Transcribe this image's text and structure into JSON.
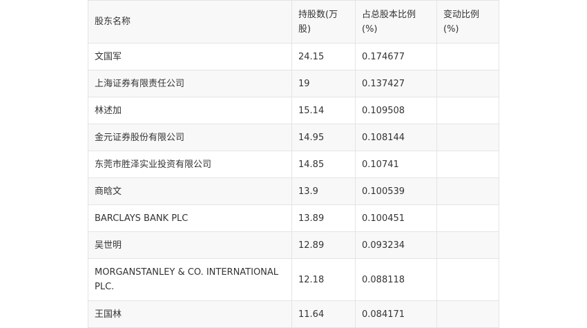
{
  "table": {
    "headers": [
      "股东名称",
      "持股数(万股)",
      "占总股本比例(%)",
      "变动比例(%)"
    ],
    "rows": [
      [
        "文国军",
        "24.15",
        "0.174677",
        ""
      ],
      [
        "上海证券有限责任公司",
        "19",
        "0.137427",
        ""
      ],
      [
        "林述加",
        "15.14",
        "0.109508",
        ""
      ],
      [
        "金元证券股份有限公司",
        "14.95",
        "0.108144",
        ""
      ],
      [
        "东莞市胜泽实业投资有限公司",
        "14.85",
        "0.10741",
        ""
      ],
      [
        "商晗文",
        "13.9",
        "0.100539",
        ""
      ],
      [
        "BARCLAYS BANK PLC",
        "13.89",
        "0.100451",
        ""
      ],
      [
        "吴世明",
        "12.89",
        "0.093234",
        ""
      ],
      [
        "MORGANSTANLEY & CO. INTERNATIONAL PLC.",
        "12.18",
        "0.088118",
        ""
      ],
      [
        "王国林",
        "11.64",
        "0.084171",
        ""
      ]
    ]
  }
}
